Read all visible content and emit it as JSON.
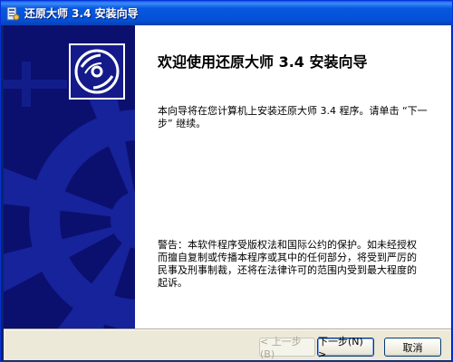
{
  "window": {
    "title": "还原大师 3.4 安装向导"
  },
  "page": {
    "heading": "欢迎使用还原大师 3.4 安装向导",
    "intro": "本向导将在您计算机上安装还原大师 3.4 程序。请单击 “下一步” 继续。",
    "warning": "警告：本软件程序受版权法和国际公约的保护。如未经授权而擅自复制或传播本程序或其中的任何部分，将受到严厉的民事及刑事制裁，还将在法律许可的范围内受到最大程度的起诉。"
  },
  "buttons": {
    "back": "< 上一步(B)",
    "next": "下一步(N) >",
    "cancel": "取消"
  },
  "icons": {
    "title": "installer-icon",
    "logo": "disc-icon"
  },
  "colors": {
    "titlebar": "#0450d6",
    "banner": "#0b0f6e",
    "banner_graphic": "#162aa8"
  }
}
